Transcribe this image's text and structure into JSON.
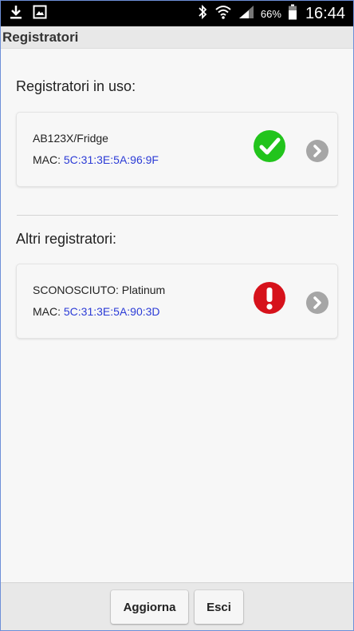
{
  "status_bar": {
    "battery_percent": "66%",
    "time": "16:44",
    "icons": [
      "download-icon",
      "image-icon",
      "bluetooth-icon",
      "wifi-icon",
      "signal-icon",
      "battery-icon"
    ]
  },
  "titlebar": {
    "title": "Registratori"
  },
  "in_use": {
    "heading": "Registratori in uso:",
    "devices": [
      {
        "name": "AB123X/Fridge",
        "mac_label": "MAC:",
        "mac": "5C:31:3E:5A:96:9F",
        "status": "ok",
        "status_icon": "check-circle-icon",
        "status_color": "#22c41c"
      }
    ]
  },
  "others": {
    "heading": "Altri registratori:",
    "devices": [
      {
        "name": "SCONOSCIUTO: Platinum",
        "mac_label": "MAC:",
        "mac": "5C:31:3E:5A:90:3D",
        "status": "warning",
        "status_icon": "exclamation-circle-icon",
        "status_color": "#d6121b"
      }
    ]
  },
  "footer": {
    "refresh_label": "Aggiorna",
    "exit_label": "Esci"
  },
  "colors": {
    "mac_link": "#2b3bd6",
    "chevron": "#a6a6a6"
  }
}
